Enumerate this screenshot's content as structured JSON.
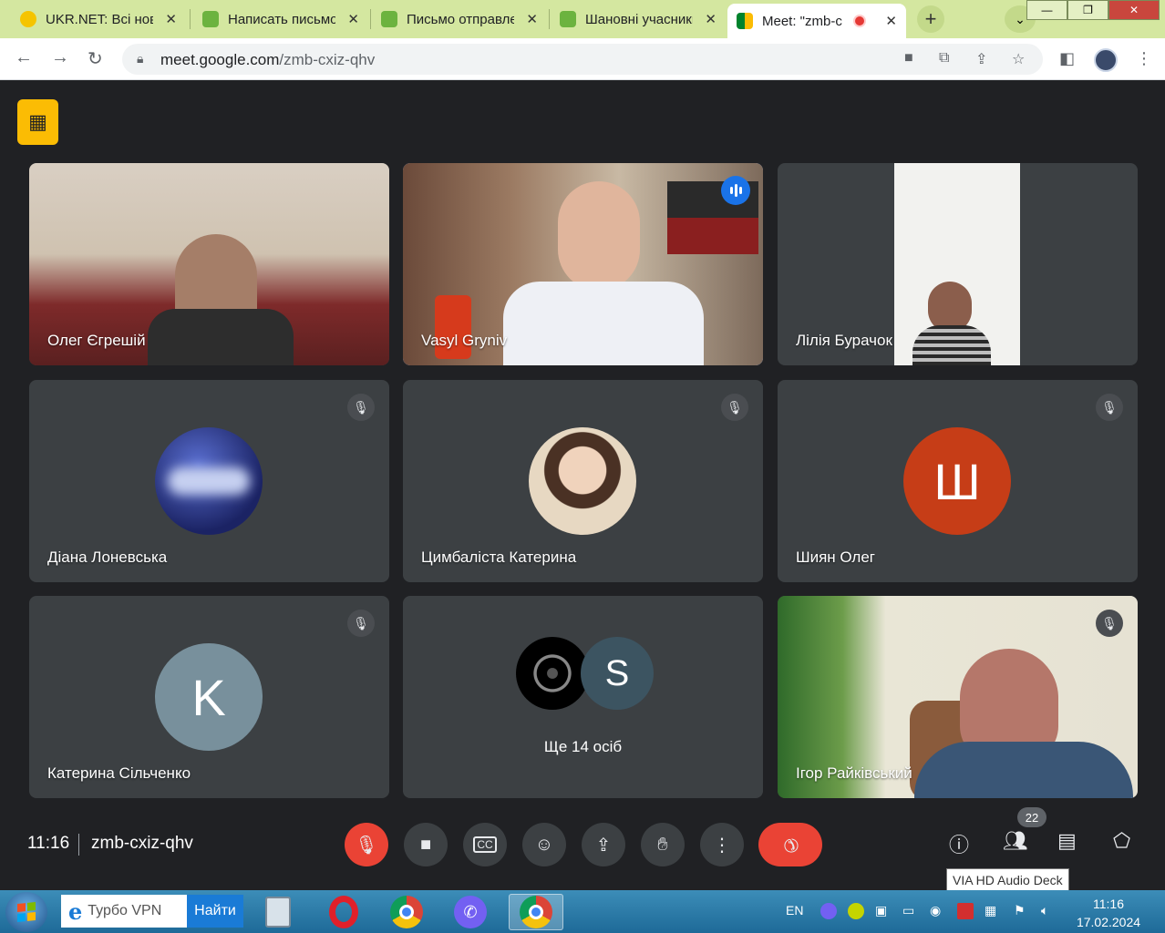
{
  "browser": {
    "tabs": [
      {
        "title": "UKR.NET: Всі нові",
        "active": false
      },
      {
        "title": "Написать письмо",
        "active": false
      },
      {
        "title": "Письмо отправлено",
        "active": false
      },
      {
        "title": "Шановні учасники",
        "active": false
      },
      {
        "title": "Meet: \"zmb-c",
        "active": true
      }
    ],
    "url_host": "meet.google.com",
    "url_path": "/zmb-cxiz-qhv"
  },
  "meet": {
    "participants": [
      {
        "name": "Олег Єгрешій",
        "muted": false,
        "speaking": false,
        "kind": "video"
      },
      {
        "name": "Vasyl Gryniv",
        "muted": false,
        "speaking": true,
        "kind": "video"
      },
      {
        "name": "Лілія Бурачок",
        "muted": false,
        "speaking": false,
        "kind": "video"
      },
      {
        "name": "Діана Лоневська",
        "muted": true,
        "speaking": false,
        "kind": "avatar"
      },
      {
        "name": "Цимбаліста Катерина",
        "muted": true,
        "speaking": false,
        "kind": "avatar"
      },
      {
        "name": "Шиян Олег",
        "muted": true,
        "speaking": false,
        "kind": "letter",
        "letter": "Ш",
        "color": "#c63d17"
      },
      {
        "name": "Катерина Сільченко",
        "muted": true,
        "speaking": false,
        "kind": "letter",
        "letter": "K",
        "color": "#78909c"
      },
      {
        "name": "Ще 14 осіб",
        "muted": false,
        "speaking": false,
        "kind": "group",
        "letter": "S"
      },
      {
        "name": "Ігор Райківський",
        "muted": true,
        "speaking": false,
        "kind": "video"
      }
    ],
    "time": "11:16",
    "meeting_code": "zmb-cxiz-qhv",
    "people_count": "22",
    "tooltip": "VIA HD Audio Deck"
  },
  "taskbar": {
    "search_text": "Турбо VPN",
    "search_button": "Найти",
    "language": "EN",
    "time": "11:16",
    "date": "17.02.2024"
  }
}
